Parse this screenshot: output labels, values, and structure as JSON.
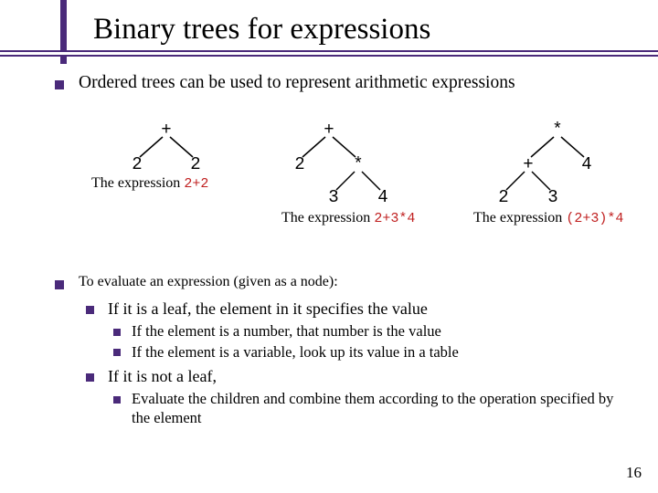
{
  "title": "Binary trees for expressions",
  "bullets": {
    "top": "Ordered trees can be used to represent arithmetic expressions",
    "eval": "To evaluate an expression (given as a node):",
    "leaf": "If it is a leaf, the element in it specifies the value",
    "leaf_num": "If the element is a number, that number is the value",
    "leaf_var": "If the element is a variable, look up its value in a table",
    "notleaf": "If it is not a leaf,",
    "combine": "Evaluate the children and combine them according to the operation specified by the element"
  },
  "trees": {
    "t1": {
      "root": "+",
      "l": "2",
      "r": "2",
      "cap_pre": "The expression ",
      "cap_expr": "2+2"
    },
    "t2": {
      "root": "+",
      "l": "2",
      "r": "*",
      "rl": "3",
      "rr": "4",
      "cap_pre": "The expression ",
      "cap_expr": "2+3*4"
    },
    "t3": {
      "root": "*",
      "l": "+",
      "r": "4",
      "ll": "2",
      "lr": "3",
      "cap_pre": "The expression ",
      "cap_expr": "(2+3)*4"
    }
  },
  "page_number": "16"
}
